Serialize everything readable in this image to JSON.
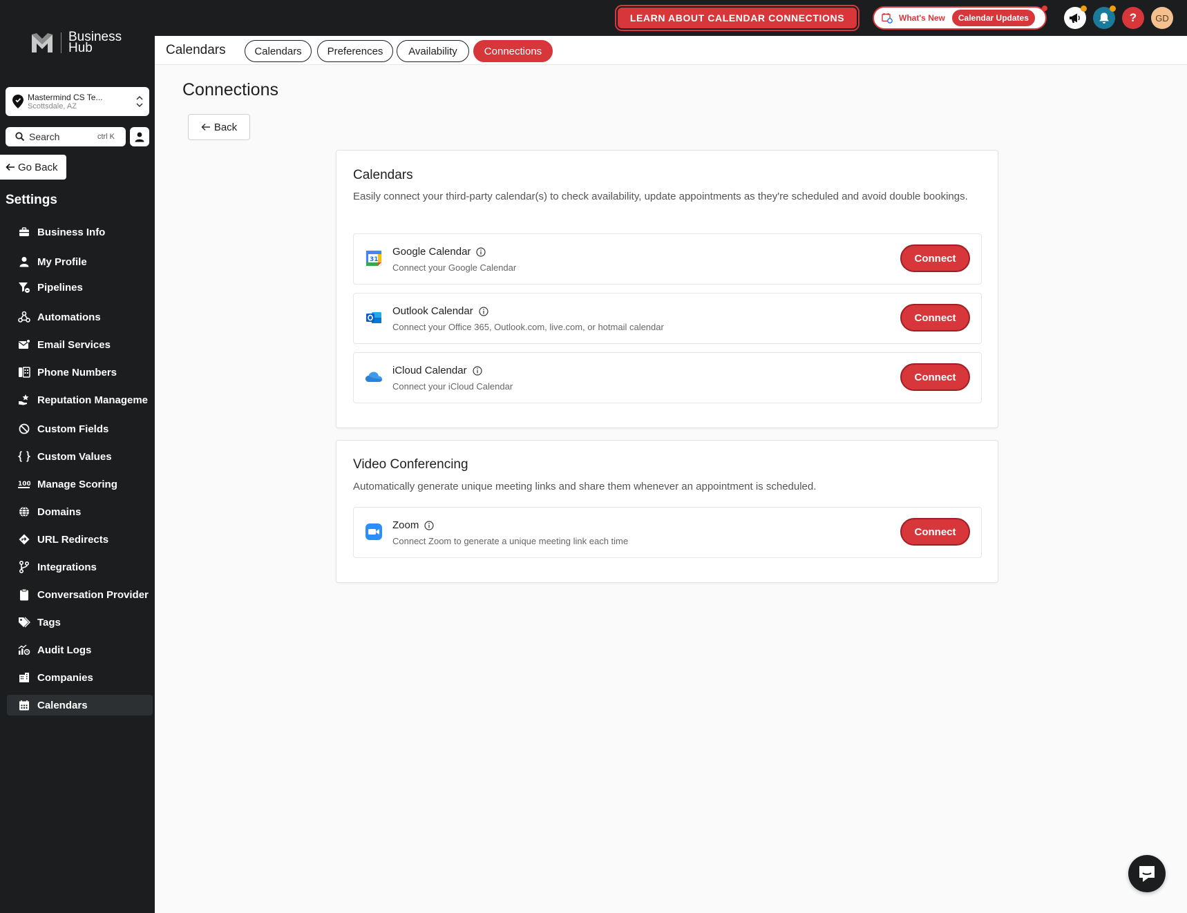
{
  "topbar": {
    "learn_label": "LEARN ABOUT CALENDAR CONNECTIONS",
    "whats_new_label": "What's New",
    "calendar_updates_label": "Calendar Updates",
    "help_label": "?",
    "avatar_initials": "GD",
    "accent_color": "#d7363b"
  },
  "sidebar": {
    "logo_line1": "Business",
    "logo_line2": "Hub",
    "location_name": "Mastermind CS Te...",
    "location_sub": "Scottsdale, AZ",
    "search_label": "Search",
    "search_shortcut": "ctrl K",
    "go_back_label": "Go Back",
    "section_title": "Settings",
    "items": [
      {
        "label": "Business Info",
        "icon": "briefcase-icon"
      },
      {
        "label": "My Profile",
        "icon": "user-icon"
      },
      {
        "label": "Pipelines",
        "icon": "funnel-icon"
      },
      {
        "label": "Automations",
        "icon": "automation-icon"
      },
      {
        "label": "Email Services",
        "icon": "email-icon"
      },
      {
        "label": "Phone Numbers",
        "icon": "phone-numbers-icon"
      },
      {
        "label": "Reputation Manageme",
        "icon": "star-hand-icon"
      },
      {
        "label": "Custom Fields",
        "icon": "custom-fields-icon"
      },
      {
        "label": "Custom Values",
        "icon": "braces-icon"
      },
      {
        "label": "Manage Scoring",
        "icon": "scoring-icon"
      },
      {
        "label": "Domains",
        "icon": "globe-icon"
      },
      {
        "label": "URL Redirects",
        "icon": "redirect-icon"
      },
      {
        "label": "Integrations",
        "icon": "integrations-icon"
      },
      {
        "label": "Conversation Provider",
        "icon": "clipboard-icon"
      },
      {
        "label": "Tags",
        "icon": "tag-icon"
      },
      {
        "label": "Audit Logs",
        "icon": "audit-icon"
      },
      {
        "label": "Companies",
        "icon": "building-icon"
      },
      {
        "label": "Calendars",
        "icon": "calendar-icon",
        "active": true
      }
    ]
  },
  "header": {
    "title": "Calendars",
    "tabs": [
      {
        "label": "Calendars"
      },
      {
        "label": "Preferences"
      },
      {
        "label": "Availability"
      },
      {
        "label": "Connections",
        "active": true
      }
    ]
  },
  "main": {
    "title": "Connections",
    "back_label": "Back",
    "calendars_section": {
      "title": "Calendars",
      "description": "Easily connect your third-party calendar(s) to check availability, update appointments as they're scheduled and avoid double bookings.",
      "items": [
        {
          "name": "Google Calendar",
          "description": "Connect your Google Calendar",
          "button": "Connect",
          "icon": "google-calendar-icon"
        },
        {
          "name": "Outlook Calendar",
          "description": "Connect your Office 365, Outlook.com, live.com, or hotmail calendar",
          "button": "Connect",
          "icon": "outlook-icon"
        },
        {
          "name": "iCloud Calendar",
          "description": "Connect your iCloud Calendar",
          "button": "Connect",
          "icon": "icloud-icon"
        }
      ]
    },
    "video_section": {
      "title": "Video Conferencing",
      "description": "Automatically generate unique meeting links and share them whenever an appointment is scheduled.",
      "items": [
        {
          "name": "Zoom",
          "description": "Connect Zoom to generate a unique meeting link each time",
          "button": "Connect",
          "icon": "zoom-icon"
        }
      ]
    }
  }
}
